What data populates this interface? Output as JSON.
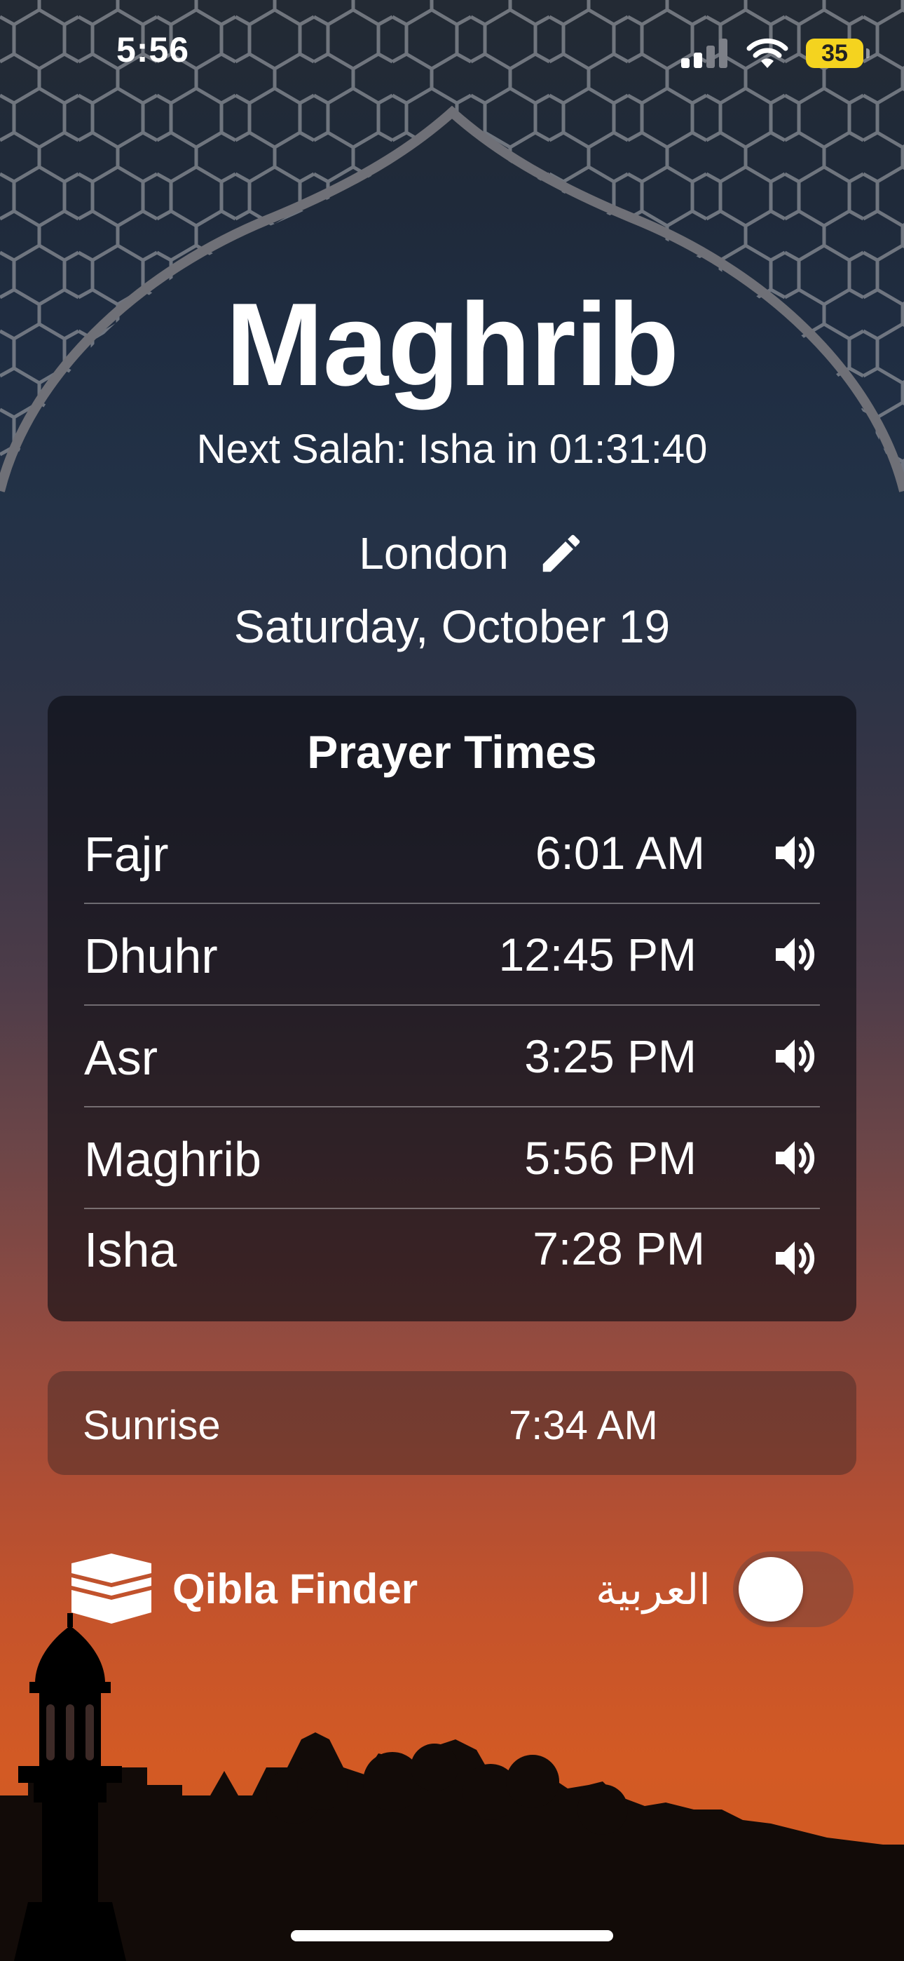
{
  "status_bar": {
    "time": "5:56",
    "battery_level": "35",
    "icons": [
      "signal-icon",
      "wifi-icon",
      "battery-icon"
    ]
  },
  "header": {
    "current_prayer": "Maghrib",
    "next_salah": "Next Salah: Isha in 01:31:40",
    "location": "London",
    "date": "Saturday, October 19"
  },
  "prayer_times": {
    "title": "Prayer Times",
    "rows": [
      {
        "name": "Fajr",
        "time": "6:01 AM"
      },
      {
        "name": "Dhuhr",
        "time": "12:45 PM"
      },
      {
        "name": "Asr",
        "time": "3:25 PM"
      },
      {
        "name": "Maghrib",
        "time": "5:56 PM"
      },
      {
        "name": "Isha",
        "time": "7:28 PM"
      }
    ]
  },
  "sunrise": {
    "label": "Sunrise",
    "time": "7:34 AM"
  },
  "footer": {
    "qibla_label": "Qibla Finder",
    "language_label": "العربية",
    "language_toggle_on": false
  },
  "colors": {
    "sky_top": "#232a34",
    "sky_bottom": "#d35a24",
    "battery": "#f4d31f",
    "text": "#ffffff"
  }
}
